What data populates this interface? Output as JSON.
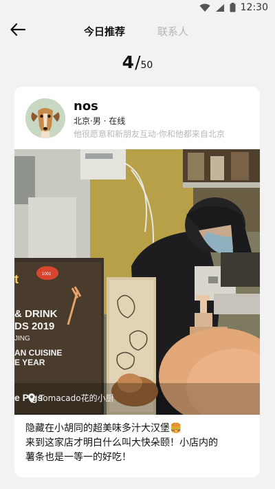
{
  "status_bar": {
    "time": "12:30",
    "icons": [
      "wifi-icon",
      "signal-icon",
      "battery-icon"
    ]
  },
  "nav": {
    "back_icon": "arrow-left-icon",
    "tab_active": "今日推荐",
    "tab_inactive": "联系人"
  },
  "counter": {
    "current": "4",
    "separator": "/",
    "total": "50"
  },
  "profile": {
    "name": "nos",
    "meta": "北京·男 · 在线",
    "bio": "他很愿意和新朋友互动·你和他都来自北京",
    "avatar_icon": "dog-avatar"
  },
  "photo": {
    "location_icon": "location-pin-icon",
    "location": "Tomacado花的小厨",
    "poster_lines": [
      "t",
      "& DRINK",
      "DS 2019",
      "JING",
      "AN CUISINE",
      "E YEAR",
      "e Pigs"
    ],
    "badge": "1001"
  },
  "caption": {
    "line1": "隐藏在小胡同的超美味多汁大汉堡🍔",
    "line2": "来到这家店才明白什么叫大快朵颐！小店内的",
    "line3": "薯条也是一等一的好吃！"
  },
  "colors": {
    "background": "#f2f2f2",
    "card": "#ffffff",
    "muted_text": "#b8b8b8",
    "inactive_tab": "#b5b5b5"
  }
}
